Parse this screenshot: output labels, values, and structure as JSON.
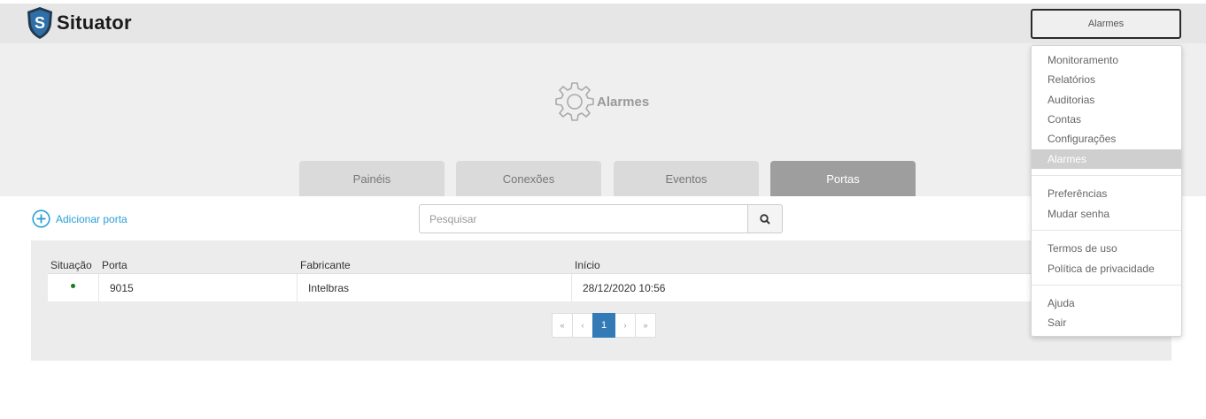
{
  "app": {
    "name": "Situator",
    "logo_letter": "S"
  },
  "header": {
    "menu_button_label": "Alarmes"
  },
  "page": {
    "title": "Alarmes",
    "icon": "gear-icon"
  },
  "tabs": [
    {
      "label": "Painéis",
      "active": false
    },
    {
      "label": "Conexões",
      "active": false
    },
    {
      "label": "Eventos",
      "active": false
    },
    {
      "label": "Portas",
      "active": true
    }
  ],
  "toolbar": {
    "add_label": "Adicionar porta",
    "search_placeholder": "Pesquisar",
    "search_icon": "search-icon"
  },
  "table": {
    "columns": [
      "Situação",
      "Porta",
      "Fabricante",
      "Início"
    ],
    "rows": [
      {
        "status": "active",
        "status_color": "#1e7a1e",
        "porta": "9015",
        "fabricante": "Intelbras",
        "inicio": "28/12/2020 10:56"
      }
    ]
  },
  "pagination": {
    "first": "«",
    "prev": "‹",
    "current": "1",
    "next": "›",
    "last": "»"
  },
  "menu": {
    "groups": [
      [
        "Monitoramento",
        "Relatórios",
        "Auditorias",
        "Contas",
        "Configurações",
        "Alarmes"
      ],
      [
        "Preferências",
        "Mudar senha"
      ],
      [
        "Termos de uso",
        "Política de privacidade"
      ],
      [
        "Ajuda",
        "Sair"
      ]
    ],
    "active_item": "Alarmes"
  },
  "colors": {
    "accent": "#2a9fd8",
    "pagination_active": "#337ab7",
    "tab_active": "#9e9e9e",
    "logo_shield": "#2f6fa7"
  }
}
